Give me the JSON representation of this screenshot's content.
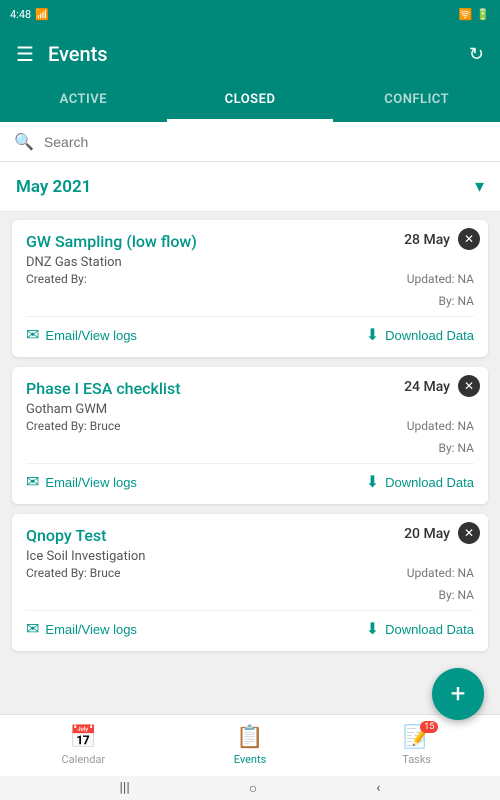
{
  "statusBar": {
    "time": "4:48",
    "icons": [
      "battery",
      "wifi",
      "signal"
    ]
  },
  "appBar": {
    "title": "Events",
    "menuIcon": "☰",
    "refreshIcon": "↻"
  },
  "tabs": [
    {
      "label": "ACTIVE",
      "active": false
    },
    {
      "label": "CLOSED",
      "active": true
    },
    {
      "label": "CONFLICT",
      "active": false
    }
  ],
  "search": {
    "placeholder": "Search"
  },
  "monthHeader": {
    "title": "May 2021",
    "chevron": "▾"
  },
  "events": [
    {
      "title": "GW Sampling (low flow)",
      "date": "28 May",
      "location": "DNZ Gas Station",
      "createdBy": "Created By:",
      "updatedLabel": "Updated: NA",
      "byLabel": "By: NA",
      "emailAction": "Email/View logs",
      "downloadAction": "Download Data"
    },
    {
      "title": "Phase I ESA checklist",
      "date": "24 May",
      "location": "Gotham GWM",
      "createdBy": "Created By: Bruce",
      "updatedLabel": "Updated: NA",
      "byLabel": "By: NA",
      "emailAction": "Email/View logs",
      "downloadAction": "Download Data"
    },
    {
      "title": "Qnopy Test",
      "date": "20 May",
      "location": "Ice Soil Investigation",
      "createdBy": "Created By: Bruce",
      "updatedLabel": "Updated: NA",
      "byLabel": "By: NA",
      "emailAction": "Email/View logs",
      "downloadAction": "Download Data"
    }
  ],
  "fab": {
    "icon": "+"
  },
  "bottomNav": [
    {
      "label": "Calendar",
      "icon": "📅",
      "active": false
    },
    {
      "label": "Events",
      "icon": "📋",
      "active": true
    },
    {
      "label": "Tasks",
      "icon": "📝",
      "active": false,
      "badge": "15"
    }
  ],
  "gestureBar": {
    "left": "|||",
    "center": "○",
    "right": "‹"
  }
}
